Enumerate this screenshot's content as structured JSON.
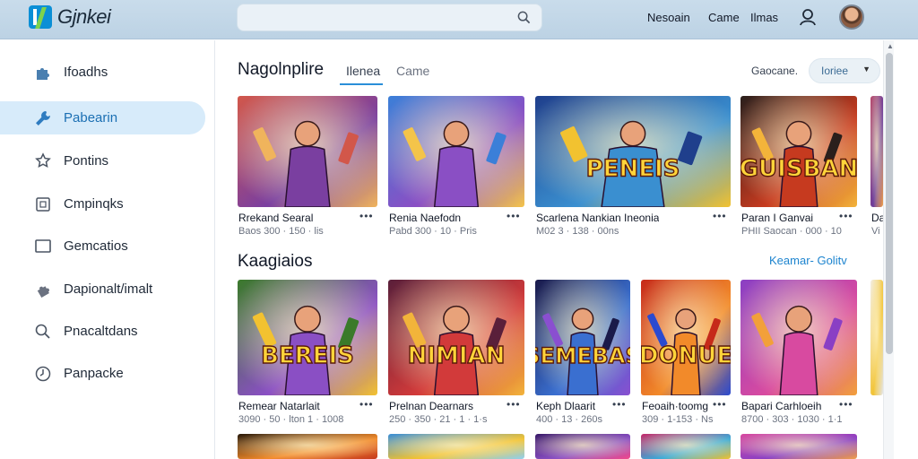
{
  "header": {
    "logo_text": "Gjnkei",
    "search_placeholder": "",
    "links": [
      "Nesoain",
      "Came",
      "Ilmas"
    ]
  },
  "sidebar": {
    "items": [
      {
        "label": "Ifoadhs",
        "icon": "puzzle-icon",
        "active": false
      },
      {
        "label": "Pabearin",
        "icon": "wrench-icon",
        "active": true
      },
      {
        "label": "Pontins",
        "icon": "star-gear-icon",
        "active": false
      },
      {
        "label": "Cmpinqks",
        "icon": "frame-icon",
        "active": false
      },
      {
        "label": "Gemcatios",
        "icon": "monitor-icon",
        "active": false
      },
      {
        "label": "Dapionalt/imalt",
        "icon": "puzzle-icon",
        "active": false
      },
      {
        "label": "Pnacaltdans",
        "icon": "search-icon",
        "active": false
      },
      {
        "label": "Panpacke",
        "icon": "clock-icon",
        "active": false
      }
    ]
  },
  "main": {
    "title": "Nagolnplire",
    "tabs": [
      {
        "label": "Ilenea",
        "active": true
      },
      {
        "label": "Came",
        "active": false
      }
    ],
    "sort_label": "Gaocane.",
    "sort_value": "Ioriee",
    "row1": [
      {
        "title": "Rrekand Searal",
        "meta": "Baos 300 · 150 · lis",
        "palette": [
          "#d2574a",
          "#7a3fa0",
          "#f0b45c"
        ],
        "art": "hero"
      },
      {
        "title": "Renia Naefodn",
        "meta": "Pabd 300 · 10 · Pris",
        "palette": [
          "#3b7fd8",
          "#8a4fc4",
          "#f4c44a"
        ],
        "art": "hero"
      },
      {
        "title": "Scarlena Nankian Ineonia",
        "meta": "M02 3 · 138 · 00ns",
        "palette": [
          "#1f3f8c",
          "#3a8fd0",
          "#f2c230"
        ],
        "art": "logo",
        "logo_text": "PENEIS"
      },
      {
        "title": "Paran I Ganvai",
        "meta": "PHII Saocan · 000 · 10",
        "palette": [
          "#2a1f1c",
          "#c63a1f",
          "#f3b43a"
        ],
        "art": "logo",
        "logo_text": "GUISBAN"
      },
      {
        "title": "Da",
        "meta": "Vis",
        "palette": [
          "#b84a6c",
          "#6a3c9c",
          "#f0a04a"
        ],
        "art": "plain"
      }
    ],
    "section_title": "Kaagiaios",
    "section_link": "Keamar- Golitv",
    "row2": [
      {
        "title": "Remear Natarlait",
        "meta": "3090 · 50 · lton 1 · 1008",
        "palette": [
          "#3a7a2a",
          "#8a4fc4",
          "#f2c230"
        ],
        "art": "logo",
        "logo_text": "BEREIS"
      },
      {
        "title": "Prelnan Dearnars",
        "meta": "250 · 350 · 21 · 1 · 1·s",
        "palette": [
          "#5a1f3a",
          "#d23a3a",
          "#f2b43a"
        ],
        "art": "logo",
        "logo_text": "NIMIAN"
      },
      {
        "title": "Keph Dlaarit",
        "meta": "400 · 13 · 260s",
        "palette": [
          "#1a1a4a",
          "#3a6fd0",
          "#8a4fd0"
        ],
        "art": "logo",
        "logo_text": "SEMEBAS"
      },
      {
        "title": "Feoaih·toomg",
        "meta": "309 · 1-153 · Ns",
        "palette": [
          "#c62a1a",
          "#f28a2a",
          "#2a4ad0"
        ],
        "art": "logo",
        "logo_text": "DONUE"
      },
      {
        "title": "Bapari Carhloeih",
        "meta": "8700 · 303 · 1030 · 1·1",
        "palette": [
          "#8a3fc4",
          "#d84aa0",
          "#f2a03a"
        ],
        "art": "hero"
      },
      {
        "title": "",
        "meta": "",
        "palette": [
          "#f3efe6",
          "#f2c230",
          "#e5e7eb"
        ],
        "art": "plain"
      }
    ],
    "row3": [
      {
        "palette": [
          "#2a1a0a",
          "#f28a2a",
          "#c63a1f"
        ]
      },
      {
        "palette": [
          "#3a8fd8",
          "#f2c230",
          "#8fd0f0"
        ]
      },
      {
        "palette": [
          "#3a1a6a",
          "#8a4fc4",
          "#f24a8a"
        ]
      },
      {
        "palette": [
          "#c62a6a",
          "#3aaad8",
          "#f2c230"
        ]
      },
      {
        "palette": [
          "#d84aa0",
          "#8a3fc4",
          "#f0a04a"
        ]
      }
    ]
  }
}
